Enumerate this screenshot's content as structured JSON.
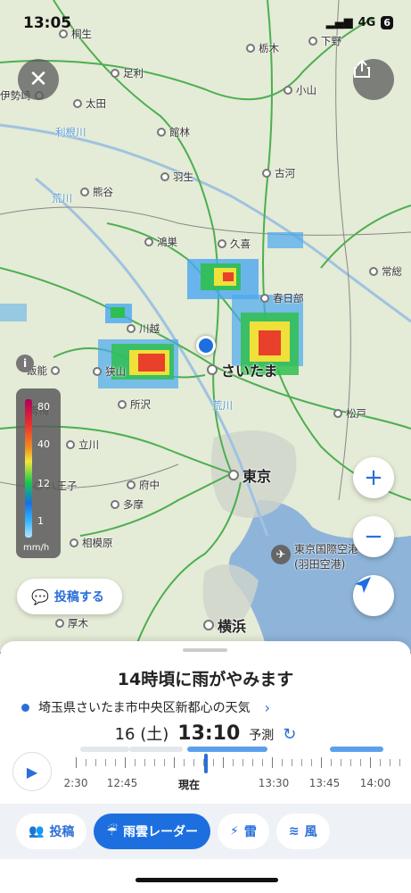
{
  "status_bar": {
    "time": "13:05",
    "network": "4G",
    "battery": "6"
  },
  "map": {
    "places": [
      {
        "name": "桐生"
      },
      {
        "name": "足利"
      },
      {
        "name": "太田"
      },
      {
        "name": "館林"
      },
      {
        "name": "羽生"
      },
      {
        "name": "古河"
      },
      {
        "name": "熊谷"
      },
      {
        "name": "鴻巣"
      },
      {
        "name": "久喜"
      },
      {
        "name": "春日部"
      },
      {
        "name": "川越"
      },
      {
        "name": "狭山"
      },
      {
        "name": "所沢"
      },
      {
        "name": "飯能"
      },
      {
        "name": "青梅"
      },
      {
        "name": "立川"
      },
      {
        "name": "八王子"
      },
      {
        "name": "府中"
      },
      {
        "name": "多摩"
      },
      {
        "name": "相模原"
      },
      {
        "name": "厚木"
      },
      {
        "name": "栃木"
      },
      {
        "name": "小山"
      },
      {
        "name": "下野"
      },
      {
        "name": "松戸"
      },
      {
        "name": "常総"
      },
      {
        "name": "伊勢崎"
      }
    ],
    "major_places": [
      {
        "name": "さいたま"
      },
      {
        "name": "東京"
      },
      {
        "name": "横浜"
      }
    ],
    "airport": "東京国際空港",
    "airport_sub": "(羽田空港)",
    "rivers": [
      "利根川",
      "荒川",
      "荒川"
    ],
    "legend": {
      "values": [
        "80",
        "40",
        "12",
        "1"
      ],
      "unit": "mm/h"
    },
    "post_button_label": "投稿する"
  },
  "sheet": {
    "headline": "14時頃に雨がやみます",
    "location": "埼玉県さいたま市中央区新都心の天気",
    "date": "16 (土)",
    "time": "13:10",
    "forecast_label": "予測",
    "timeline_labels": [
      "2:30",
      "12:45",
      "現在",
      "13:30",
      "13:45",
      "14:00"
    ]
  },
  "tabs": [
    {
      "label": "投稿",
      "icon": "people-icon"
    },
    {
      "label": "雨雲レーダー",
      "icon": "rain-cloud-icon",
      "active": true
    },
    {
      "label": "雷",
      "icon": "lightning-icon"
    },
    {
      "label": "風",
      "icon": "wind-icon"
    }
  ],
  "colors": {
    "accent": "#1d6fe0",
    "map_bg": "#e4ebd6",
    "road": "#4caf50",
    "sea": "#8fb4d9"
  }
}
